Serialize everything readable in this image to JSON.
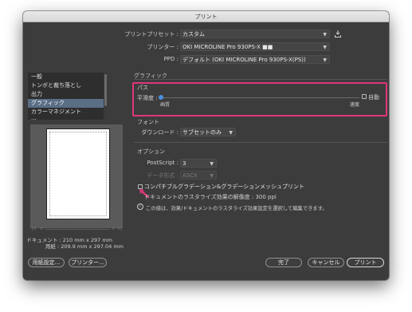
{
  "window": {
    "title": "プリント"
  },
  "header": {
    "preset_label": "プリントプリセット :",
    "preset_value": "カスタム",
    "printer_label": "プリンター :",
    "printer_value": "OKI MICROLINE Pro 930PS-X ■■",
    "ppd_label": "PPD :",
    "ppd_value": "デフォルト (OKI MICROLINE Pro 930PS-X(PS))"
  },
  "sidebar": {
    "items": [
      {
        "label": "一般",
        "selected": false
      },
      {
        "label": "トンボと裁ち落とし",
        "selected": false
      },
      {
        "label": "出力",
        "selected": false
      },
      {
        "label": "グラフィック",
        "selected": true
      },
      {
        "label": "カラーマネジメント",
        "selected": false
      },
      {
        "label": "...",
        "selected": false
      }
    ]
  },
  "preview": {
    "pager_first": "|<",
    "pager_prev": "<",
    "pager_next": ">",
    "pager_last": ">|",
    "document_label": "ドキュメント : 210 mm x 297 mm",
    "paper_label": "用紙 : 209.9 mm x 297.04 mm"
  },
  "graphics": {
    "section_title": "グラフィック",
    "paths": {
      "title": "パス",
      "flatness_label": "平滑度 :",
      "flatness_value": 0.0,
      "min_label": "画質",
      "max_label": "速度",
      "auto_label": "自動",
      "auto_checked": false
    },
    "fonts": {
      "title": "フォント",
      "download_label": "ダウンロード :",
      "download_value": "サブセットのみ"
    },
    "options": {
      "title": "オプション",
      "postscript_label": "PostScript :",
      "postscript_value": "3",
      "data_format_label": "データ形式 :",
      "data_format_value": "ASCII",
      "compat_gradient_label": "コンパチブルグラデーション&グラデーションメッシュプリント",
      "compat_gradient_checked": false,
      "raster_resolution": "ドキュメントのラスタライズ効果の解像度 : 300 ppi",
      "info_text": "この値は、効果/ドキュメントのラスタライズ効果設定を選択して編集できます。"
    }
  },
  "footer": {
    "page_setup": "用紙設定...",
    "printer": "プリンター...",
    "done": "完了",
    "cancel": "キャンセル",
    "print": "プリント"
  },
  "colors": {
    "highlight": "#e2357a",
    "cursor": "#e2357a",
    "slider": "#4a90e2",
    "selection": "#5a6e86"
  }
}
